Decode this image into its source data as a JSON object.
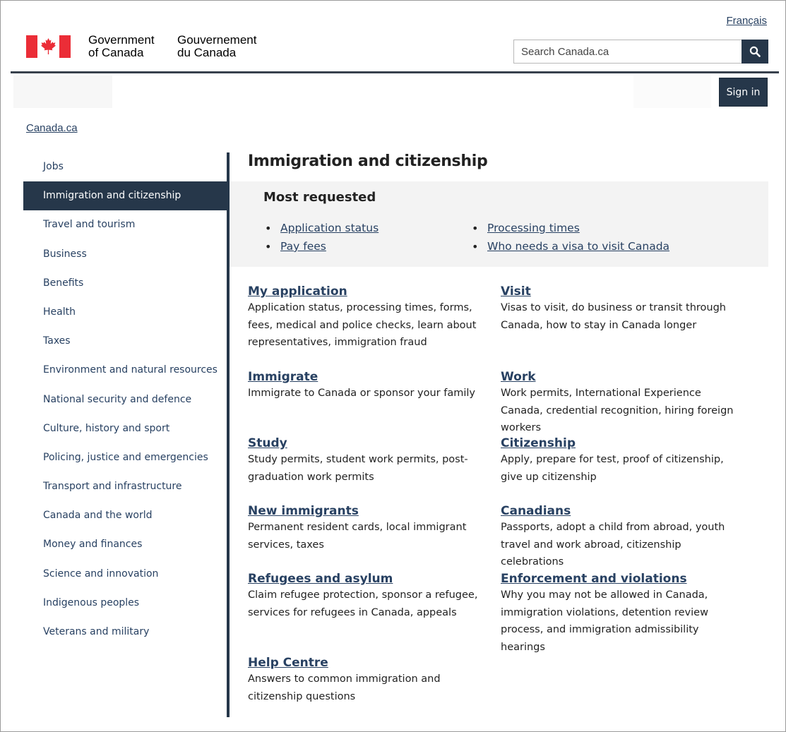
{
  "header": {
    "language_link": "Français",
    "signature_en_line1": "Government",
    "signature_en_line2": "of Canada",
    "signature_fr_line1": "Gouvernement",
    "signature_fr_line2": "du Canada",
    "search_placeholder": "Search Canada.ca",
    "sign_in": "Sign in"
  },
  "breadcrumb": "Canada.ca",
  "sidebar": {
    "items": [
      {
        "label": "Jobs"
      },
      {
        "label": "Immigration and citizenship",
        "active": true
      },
      {
        "label": "Travel and tourism"
      },
      {
        "label": "Business"
      },
      {
        "label": "Benefits"
      },
      {
        "label": "Health"
      },
      {
        "label": "Taxes"
      },
      {
        "label": "Environment and natural resources"
      },
      {
        "label": "National security and defence"
      },
      {
        "label": "Culture, history and sport"
      },
      {
        "label": "Policing, justice and emergencies"
      },
      {
        "label": "Transport and infrastructure"
      },
      {
        "label": "Canada and the world"
      },
      {
        "label": "Money and finances"
      },
      {
        "label": "Science and innovation"
      },
      {
        "label": "Indigenous peoples"
      },
      {
        "label": "Veterans and military"
      }
    ]
  },
  "main": {
    "title": "Immigration and citizenship",
    "most_requested": {
      "title": "Most requested",
      "left": [
        "Application status",
        "Pay fees"
      ],
      "right": [
        "Processing times",
        "Who needs a visa to visit Canada"
      ]
    },
    "tasks": [
      {
        "title": "My application",
        "desc": "Application status, processing times, forms, fees, medical and police checks, learn about representatives, immigration fraud"
      },
      {
        "title": "Visit",
        "desc": "Visas to visit, do business or transit through Canada, how to stay in Canada longer"
      },
      {
        "title": "Immigrate",
        "desc": "Immigrate to Canada or sponsor your family"
      },
      {
        "title": "Work",
        "desc": "Work permits, International Experience Canada, credential recognition, hiring foreign workers"
      },
      {
        "title": "Study",
        "desc": "Study permits, student work permits, post-graduation work permits"
      },
      {
        "title": "Citizenship",
        "desc": "Apply, prepare for test, proof of citizenship, give up citizenship"
      },
      {
        "title": "New immigrants",
        "desc": "Permanent resident cards, local immigrant services, taxes"
      },
      {
        "title": "Canadians",
        "desc": "Passports, adopt a child from abroad, youth travel and work abroad, citizenship celebrations"
      },
      {
        "title": "Refugees and asylum",
        "desc": "Claim refugee protection, sponsor a refugee, services for refugees in Canada, appeals"
      },
      {
        "title": "Enforcement and violations",
        "desc": "Why you may not be allowed in Canada, immigration violations, detention review process, and immigration admissibility hearings"
      },
      {
        "title": "Help Centre",
        "desc": "Answers to common immigration and citizenship questions"
      }
    ]
  },
  "colors": {
    "primary_dark": "#26374a",
    "link": "#284162",
    "flag_red": "#eb2d37",
    "panel_bg": "#f3f3f3"
  }
}
